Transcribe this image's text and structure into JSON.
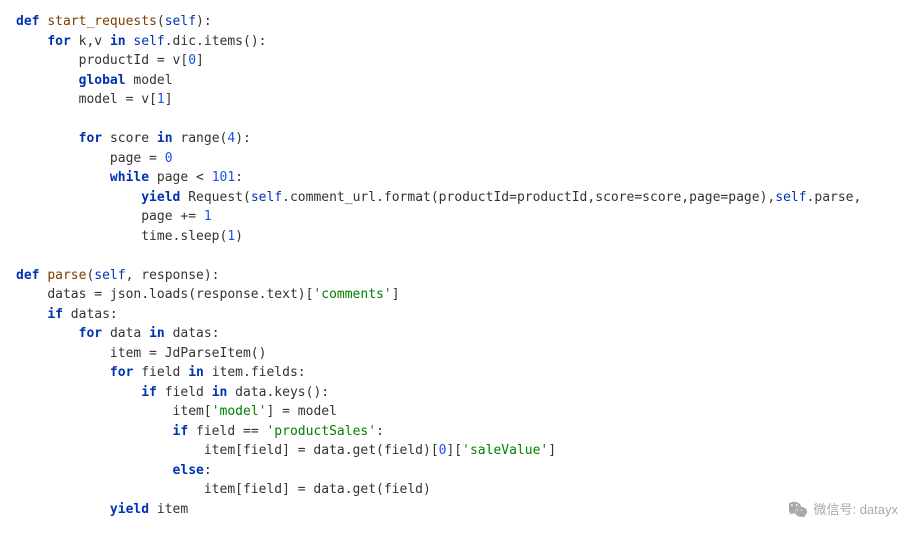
{
  "code": {
    "lines": [
      {
        "indent": 0,
        "tokens": [
          {
            "t": "def ",
            "c": "kw"
          },
          {
            "t": "start_requests",
            "c": "fn"
          },
          {
            "t": "(",
            "c": "op"
          },
          {
            "t": "self",
            "c": "builtin"
          },
          {
            "t": "):",
            "c": "op"
          }
        ]
      },
      {
        "indent": 1,
        "tokens": [
          {
            "t": "for ",
            "c": "kw"
          },
          {
            "t": "k,v ",
            "c": "plain"
          },
          {
            "t": "in ",
            "c": "kw"
          },
          {
            "t": "self",
            "c": "builtin"
          },
          {
            "t": ".dic.items():",
            "c": "plain"
          }
        ]
      },
      {
        "indent": 2,
        "tokens": [
          {
            "t": "productId = v[",
            "c": "plain"
          },
          {
            "t": "0",
            "c": "num"
          },
          {
            "t": "]",
            "c": "plain"
          }
        ]
      },
      {
        "indent": 2,
        "tokens": [
          {
            "t": "global ",
            "c": "kw"
          },
          {
            "t": "model",
            "c": "plain"
          }
        ]
      },
      {
        "indent": 2,
        "tokens": [
          {
            "t": "model = v[",
            "c": "plain"
          },
          {
            "t": "1",
            "c": "num"
          },
          {
            "t": "]",
            "c": "plain"
          }
        ]
      },
      {
        "indent": 0,
        "tokens": [
          {
            "t": "",
            "c": "plain"
          }
        ]
      },
      {
        "indent": 2,
        "tokens": [
          {
            "t": "for ",
            "c": "kw"
          },
          {
            "t": "score ",
            "c": "plain"
          },
          {
            "t": "in ",
            "c": "kw"
          },
          {
            "t": "range",
            "c": "plain"
          },
          {
            "t": "(",
            "c": "op"
          },
          {
            "t": "4",
            "c": "num"
          },
          {
            "t": "):",
            "c": "op"
          }
        ]
      },
      {
        "indent": 3,
        "tokens": [
          {
            "t": "page = ",
            "c": "plain"
          },
          {
            "t": "0",
            "c": "num"
          }
        ]
      },
      {
        "indent": 3,
        "tokens": [
          {
            "t": "while ",
            "c": "kw"
          },
          {
            "t": "page < ",
            "c": "plain"
          },
          {
            "t": "101",
            "c": "num"
          },
          {
            "t": ":",
            "c": "op"
          }
        ]
      },
      {
        "indent": 4,
        "tokens": [
          {
            "t": "yield ",
            "c": "kw"
          },
          {
            "t": "Request(",
            "c": "plain"
          },
          {
            "t": "self",
            "c": "builtin"
          },
          {
            "t": ".comment_url.format(productId=productId,score=score,page=page),",
            "c": "plain"
          },
          {
            "t": "self",
            "c": "builtin"
          },
          {
            "t": ".parse,",
            "c": "plain"
          }
        ]
      },
      {
        "indent": 4,
        "tokens": [
          {
            "t": "page += ",
            "c": "plain"
          },
          {
            "t": "1",
            "c": "num"
          }
        ]
      },
      {
        "indent": 4,
        "tokens": [
          {
            "t": "time.sleep(",
            "c": "plain"
          },
          {
            "t": "1",
            "c": "num"
          },
          {
            "t": ")",
            "c": "plain"
          }
        ]
      },
      {
        "indent": 0,
        "tokens": [
          {
            "t": "",
            "c": "plain"
          }
        ]
      },
      {
        "indent": 0,
        "tokens": [
          {
            "t": "def ",
            "c": "kw"
          },
          {
            "t": "parse",
            "c": "fn"
          },
          {
            "t": "(",
            "c": "op"
          },
          {
            "t": "self",
            "c": "builtin"
          },
          {
            "t": ", response):",
            "c": "plain"
          }
        ]
      },
      {
        "indent": 1,
        "tokens": [
          {
            "t": "datas = json.loads(response.text)[",
            "c": "plain"
          },
          {
            "t": "'comments'",
            "c": "str"
          },
          {
            "t": "]",
            "c": "plain"
          }
        ]
      },
      {
        "indent": 1,
        "tokens": [
          {
            "t": "if ",
            "c": "kw"
          },
          {
            "t": "datas:",
            "c": "plain"
          }
        ]
      },
      {
        "indent": 2,
        "tokens": [
          {
            "t": "for ",
            "c": "kw"
          },
          {
            "t": "data ",
            "c": "plain"
          },
          {
            "t": "in ",
            "c": "kw"
          },
          {
            "t": "datas:",
            "c": "plain"
          }
        ]
      },
      {
        "indent": 3,
        "tokens": [
          {
            "t": "item = JdParseItem()",
            "c": "plain"
          }
        ]
      },
      {
        "indent": 3,
        "tokens": [
          {
            "t": "for ",
            "c": "kw"
          },
          {
            "t": "field ",
            "c": "plain"
          },
          {
            "t": "in ",
            "c": "kw"
          },
          {
            "t": "item.fields:",
            "c": "plain"
          }
        ]
      },
      {
        "indent": 4,
        "tokens": [
          {
            "t": "if ",
            "c": "kw"
          },
          {
            "t": "field ",
            "c": "plain"
          },
          {
            "t": "in ",
            "c": "kw"
          },
          {
            "t": "data.keys():",
            "c": "plain"
          }
        ]
      },
      {
        "indent": 5,
        "tokens": [
          {
            "t": "item[",
            "c": "plain"
          },
          {
            "t": "'model'",
            "c": "str"
          },
          {
            "t": "] = model",
            "c": "plain"
          }
        ]
      },
      {
        "indent": 5,
        "tokens": [
          {
            "t": "if ",
            "c": "kw"
          },
          {
            "t": "field == ",
            "c": "plain"
          },
          {
            "t": "'productSales'",
            "c": "str"
          },
          {
            "t": ":",
            "c": "op"
          }
        ]
      },
      {
        "indent": 6,
        "tokens": [
          {
            "t": "item[field] = data.get(field)[",
            "c": "plain"
          },
          {
            "t": "0",
            "c": "num"
          },
          {
            "t": "][",
            "c": "plain"
          },
          {
            "t": "'saleValue'",
            "c": "str"
          },
          {
            "t": "]",
            "c": "plain"
          }
        ]
      },
      {
        "indent": 5,
        "tokens": [
          {
            "t": "else",
            "c": "kw"
          },
          {
            "t": ":",
            "c": "op"
          }
        ]
      },
      {
        "indent": 6,
        "tokens": [
          {
            "t": "item[field] = data.get(field)",
            "c": "plain"
          }
        ]
      },
      {
        "indent": 3,
        "tokens": [
          {
            "t": "yield ",
            "c": "kw"
          },
          {
            "t": "item",
            "c": "plain"
          }
        ]
      }
    ]
  },
  "watermark": {
    "label": "微信号: datayx"
  }
}
